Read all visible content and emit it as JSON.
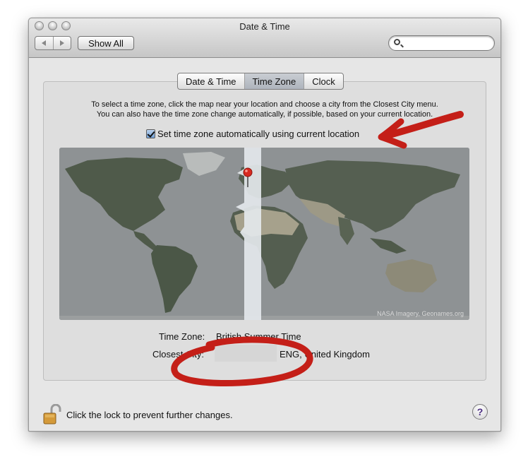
{
  "window": {
    "title": "Date & Time"
  },
  "toolbar": {
    "show_all_label": "Show All",
    "search_value": ""
  },
  "tabs": [
    {
      "label": "Date & Time",
      "selected": false
    },
    {
      "label": "Time Zone",
      "selected": true
    },
    {
      "label": "Clock",
      "selected": false
    }
  ],
  "timezone": {
    "instructions_line1": "To select a time zone, click the map near your location and choose a city from the Closest City menu.",
    "instructions_line2": "You can also have the time zone change automatically, if possible, based on your current location.",
    "auto_label": "Set time zone automatically using current location",
    "auto_checked": true,
    "map_credit": "NASA Imagery, Geonames.org",
    "time_zone_label": "Time Zone:",
    "time_zone_value": "British Summer Time",
    "closest_city_label": "Closest City:",
    "closest_city_value": "ENG, United Kingdom"
  },
  "footer": {
    "lock_text": "Click the lock to prevent further changes.",
    "help_label": "?"
  },
  "colors": {
    "annotation_red": "#c41f18",
    "highlight_band": "#e4e8ec",
    "land": "#4f5a4a",
    "desert": "#a6a18c"
  },
  "icons": {
    "lock": "lock-open-icon",
    "help": "help-icon",
    "pin": "location-pin-icon",
    "search": "search-icon"
  }
}
